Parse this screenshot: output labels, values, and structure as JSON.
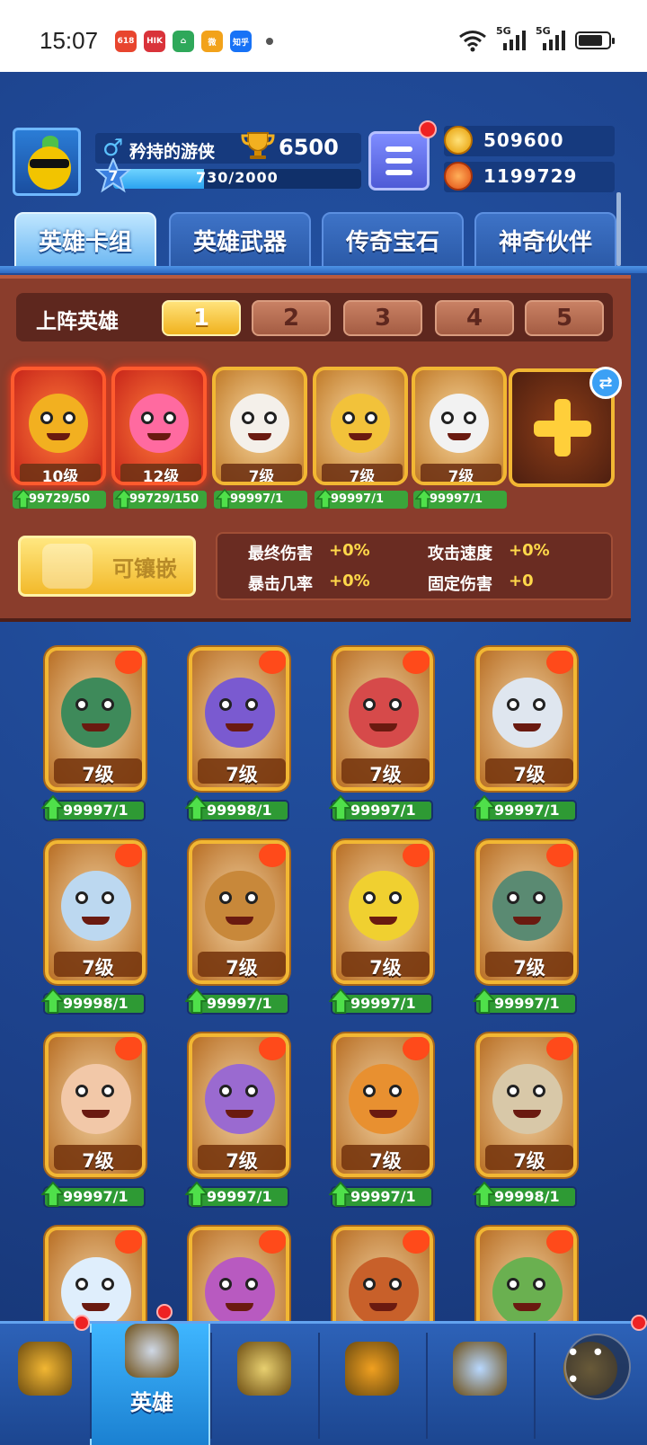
{
  "status_bar": {
    "time": "15:07",
    "apps": [
      {
        "icon": "618-app-icon",
        "text": "618",
        "color": "#e8452e"
      },
      {
        "icon": "hikvision-app-icon",
        "text": "HIK",
        "color": "#d9333a"
      },
      {
        "icon": "home-app-icon",
        "text": "⌂",
        "color": "#2fa85a"
      },
      {
        "icon": "weibo-app-icon",
        "text": "微",
        "color": "#f2a21a"
      },
      {
        "icon": "zhihu-app-icon",
        "text": "知乎",
        "color": "#1772f6"
      }
    ],
    "network_labels": [
      "5G",
      "5G"
    ],
    "battery_level": 0.8
  },
  "profile": {
    "name": "矜持的游侠",
    "gender_icon": "♂",
    "trophies": "6500",
    "level": "7",
    "xp_text": "730/2000",
    "xp_fraction": 0.365
  },
  "currencies": {
    "gold": "509600",
    "gems": "1199729"
  },
  "tabs": [
    {
      "label": "英雄卡组",
      "active": true
    },
    {
      "label": "英雄武器",
      "active": false
    },
    {
      "label": "传奇宝石",
      "active": false
    },
    {
      "label": "神奇伙伴",
      "active": false
    }
  ],
  "lineup": {
    "title": "上阵英雄",
    "slots": [
      "1",
      "2",
      "3",
      "4",
      "5"
    ],
    "active_slot": "1",
    "heroes": [
      {
        "level": "10级",
        "fragments": "99729/50",
        "color": "#f2b020",
        "frame": "red",
        "progress": 1.0
      },
      {
        "level": "12级",
        "fragments": "99729/150",
        "color": "#ff6aa0",
        "frame": "red",
        "progress": 1.0
      },
      {
        "level": "7级",
        "fragments": "99997/1",
        "color": "#f4f0ea",
        "frame": "gold",
        "progress": 1.0
      },
      {
        "level": "7级",
        "fragments": "99997/1",
        "color": "#f2c23a",
        "frame": "gold",
        "progress": 1.0
      },
      {
        "level": "7级",
        "fragments": "99997/1",
        "color": "#f2f2f2",
        "frame": "gold",
        "progress": 1.0
      }
    ]
  },
  "inlay_button": "可镶嵌",
  "stats": [
    {
      "label": "最终伤害",
      "value": "+0%"
    },
    {
      "label": "攻击速度",
      "value": "+0%"
    },
    {
      "label": "暴击几率",
      "value": "+0%"
    },
    {
      "label": "固定伤害",
      "value": "+0"
    }
  ],
  "hero_grid": [
    {
      "level": "7级",
      "fragments": "99997/1",
      "color": "#3e8a5a",
      "progress": 1.0
    },
    {
      "level": "7级",
      "fragments": "99998/1",
      "color": "#7a5ad0",
      "progress": 1.0
    },
    {
      "level": "7级",
      "fragments": "99997/1",
      "color": "#d64a4a",
      "progress": 1.0
    },
    {
      "level": "7级",
      "fragments": "99997/1",
      "color": "#dfe6ef",
      "progress": 1.0
    },
    {
      "level": "7级",
      "fragments": "99998/1",
      "color": "#bcd8f0",
      "progress": 1.0
    },
    {
      "level": "7级",
      "fragments": "99997/1",
      "color": "#c8883a",
      "progress": 1.0
    },
    {
      "level": "7级",
      "fragments": "99997/1",
      "color": "#f0d030",
      "progress": 1.0
    },
    {
      "level": "7级",
      "fragments": "99997/1",
      "color": "#5a8a72",
      "progress": 1.0
    },
    {
      "level": "7级",
      "fragments": "99997/1",
      "color": "#f2c8a8",
      "progress": 1.0
    },
    {
      "level": "7级",
      "fragments": "99997/1",
      "color": "#9a6ad0",
      "progress": 1.0
    },
    {
      "level": "7级",
      "fragments": "99997/1",
      "color": "#e89030",
      "progress": 1.0
    },
    {
      "level": "7级",
      "fragments": "99998/1",
      "color": "#d8c8a8",
      "progress": 1.0
    },
    {
      "color": "#dfeefc"
    },
    {
      "color": "#b85ac0"
    },
    {
      "color": "#c8602a"
    },
    {
      "color": "#6ab050"
    }
  ],
  "bottom_nav": [
    {
      "icon": "treasure-chest-icon",
      "label": "",
      "active": false,
      "badge": true
    },
    {
      "icon": "helmet-icon",
      "label": "英雄",
      "active": true,
      "badge": true
    },
    {
      "icon": "crossed-swords-icon",
      "label": "",
      "active": false,
      "badge": false
    },
    {
      "icon": "crown-shield-icon",
      "label": "",
      "active": false,
      "badge": false
    },
    {
      "icon": "guild-icon",
      "label": "",
      "active": false,
      "badge": false
    },
    {
      "icon": "compass-icon",
      "label": "",
      "active": false,
      "badge": true
    }
  ],
  "more_button": "• • •"
}
